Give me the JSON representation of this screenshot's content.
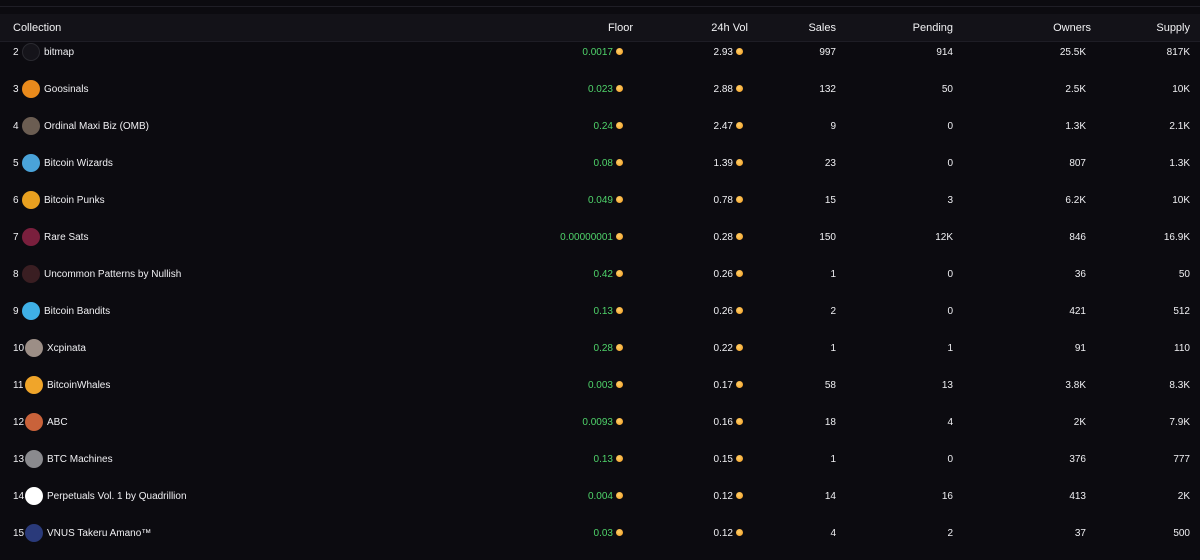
{
  "columns": {
    "collection": "Collection",
    "floor": "Floor",
    "vol": "24h Vol",
    "sales": "Sales",
    "pending": "Pending",
    "owners": "Owners",
    "supply": "Supply"
  },
  "rows": [
    {
      "rank": "2",
      "name": "bitmap",
      "floor": "0.0017",
      "vol": "2.93",
      "sales": "997",
      "pending": "914",
      "owners": "25.5K",
      "supply": "817K",
      "avatar_color": "#15141a",
      "avatar_text": "bitmap"
    },
    {
      "rank": "3",
      "name": "Goosinals",
      "floor": "0.023",
      "vol": "2.88",
      "sales": "132",
      "pending": "50",
      "owners": "2.5K",
      "supply": "10K",
      "avatar_color": "#e98a1c",
      "avatar_text": ""
    },
    {
      "rank": "4",
      "name": "Ordinal Maxi Biz (OMB)",
      "floor": "0.24",
      "vol": "2.47",
      "sales": "9",
      "pending": "0",
      "owners": "1.3K",
      "supply": "2.1K",
      "avatar_color": "#6b5d52",
      "avatar_text": ""
    },
    {
      "rank": "5",
      "name": "Bitcoin Wizards",
      "floor": "0.08",
      "vol": "1.39",
      "sales": "23",
      "pending": "0",
      "owners": "807",
      "supply": "1.3K",
      "avatar_color": "#4aa3d9",
      "avatar_text": ""
    },
    {
      "rank": "6",
      "name": "Bitcoin Punks",
      "floor": "0.049",
      "vol": "0.78",
      "sales": "15",
      "pending": "3",
      "owners": "6.2K",
      "supply": "10K",
      "avatar_color": "#e8a020",
      "avatar_text": ""
    },
    {
      "rank": "7",
      "name": "Rare Sats",
      "floor": "0.00000001",
      "vol": "0.28",
      "sales": "150",
      "pending": "12K",
      "owners": "846",
      "supply": "16.9K",
      "avatar_color": "#7a1f3d",
      "avatar_text": ""
    },
    {
      "rank": "8",
      "name": "Uncommon Patterns by Nullish",
      "floor": "0.42",
      "vol": "0.26",
      "sales": "1",
      "pending": "0",
      "owners": "36",
      "supply": "50",
      "avatar_color": "#3a1e22",
      "avatar_text": ""
    },
    {
      "rank": "9",
      "name": "Bitcoin Bandits",
      "floor": "0.13",
      "vol": "0.26",
      "sales": "2",
      "pending": "0",
      "owners": "421",
      "supply": "512",
      "avatar_color": "#3fb0e6",
      "avatar_text": ""
    },
    {
      "rank": "10",
      "name": "Xcpinata",
      "floor": "0.28",
      "vol": "0.22",
      "sales": "1",
      "pending": "1",
      "owners": "91",
      "supply": "110",
      "avatar_color": "#9c8e86",
      "avatar_text": ""
    },
    {
      "rank": "11",
      "name": "BitcoinWhales",
      "floor": "0.003",
      "vol": "0.17",
      "sales": "58",
      "pending": "13",
      "owners": "3.8K",
      "supply": "8.3K",
      "avatar_color": "#f0a52a",
      "avatar_text": ""
    },
    {
      "rank": "12",
      "name": "ABC",
      "floor": "0.0093",
      "vol": "0.16",
      "sales": "18",
      "pending": "4",
      "owners": "2K",
      "supply": "7.9K",
      "avatar_color": "#c9623a",
      "avatar_text": ""
    },
    {
      "rank": "13",
      "name": "BTC Machines",
      "floor": "0.13",
      "vol": "0.15",
      "sales": "1",
      "pending": "0",
      "owners": "376",
      "supply": "777",
      "avatar_color": "#8a8a8e",
      "avatar_text": ""
    },
    {
      "rank": "14",
      "name": "Perpetuals Vol. 1 by Quadrillion",
      "floor": "0.004",
      "vol": "0.12",
      "sales": "14",
      "pending": "16",
      "owners": "413",
      "supply": "2K",
      "avatar_color": "#ffffff",
      "avatar_text": ""
    },
    {
      "rank": "15",
      "name": "VNUS Takeru Amano™",
      "floor": "0.03",
      "vol": "0.12",
      "sales": "4",
      "pending": "2",
      "owners": "37",
      "supply": "500",
      "avatar_color": "#2a3a7a",
      "avatar_text": ""
    }
  ]
}
